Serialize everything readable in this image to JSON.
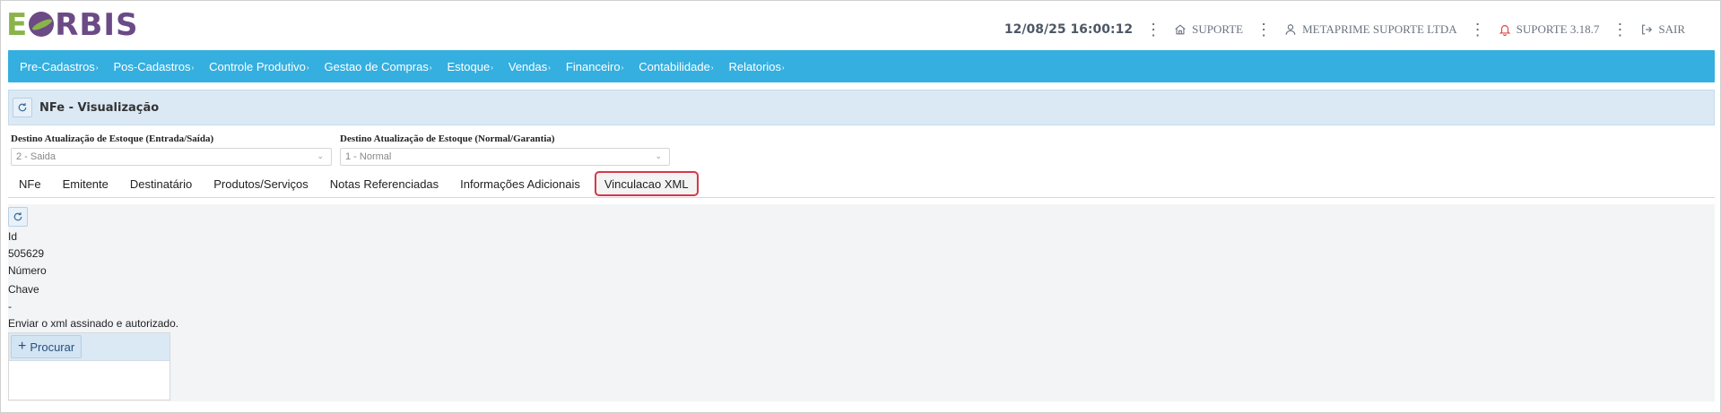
{
  "brand": {
    "letter_e": "E",
    "rest": "RBIS"
  },
  "header": {
    "datetime": "12/08/25 16:00:12",
    "suporte": "SUPORTE",
    "company": "METAPRIME SUPORTE LTDA",
    "version": "SUPORTE 3.18.7",
    "logout": "SAIR"
  },
  "nav": {
    "items": [
      "Pre-Cadastros",
      "Pos-Cadastros",
      "Controle Produtivo",
      "Gestao de Compras",
      "Estoque",
      "Vendas",
      "Financeiro",
      "Contabilidade",
      "Relatorios"
    ],
    "caret": "›"
  },
  "panel": {
    "title": "NFe - Visualização"
  },
  "fields": {
    "destino_es": {
      "label": "Destino Atualização de Estoque (Entrada/Saída)",
      "value": "2 - Saida"
    },
    "destino_ng": {
      "label": "Destino Atualização de Estoque (Normal/Garantia)",
      "value": "1 - Normal"
    }
  },
  "tabs": [
    "NFe",
    "Emitente",
    "Destinatário",
    "Produtos/Serviços",
    "Notas Referenciadas",
    "Informações Adicionais",
    "Vinculacao XML"
  ],
  "content": {
    "id_label": "Id",
    "id_value": "505629",
    "numero_label": "Número",
    "chave_label": "Chave",
    "chave_value": "-",
    "instruction": "Enviar o xml assinado e autorizado.",
    "procurar_plus": "+",
    "procurar_label": "Procurar"
  },
  "colors": {
    "nav": "#34afdf",
    "panel": "#dbe9f5",
    "active_tab_border": "#d9364a",
    "brand_purple": "#6b4a86",
    "brand_green": "#8ab34a"
  }
}
